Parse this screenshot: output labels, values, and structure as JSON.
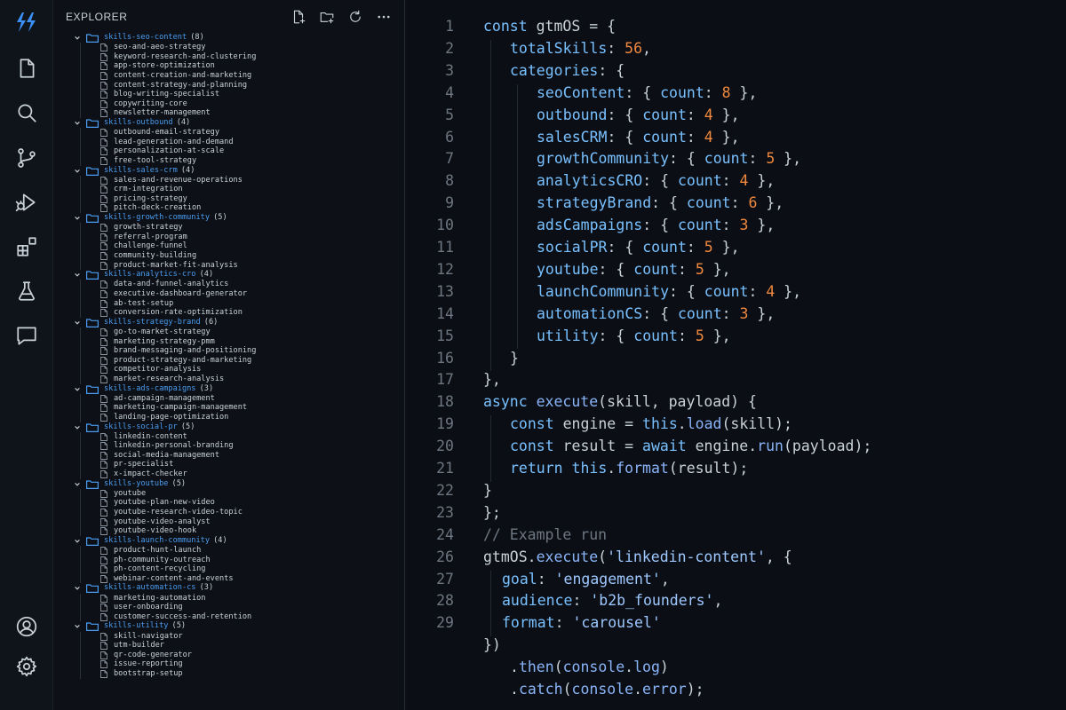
{
  "explorer": {
    "title": "EXPLORER",
    "folders": [
      {
        "name": "skills-seo-content",
        "count": "(8)",
        "files": [
          "seo-and-aeo-strategy",
          "keyword-research-and-clustering",
          "app-store-optimization",
          "content-creation-and-marketing",
          "content-strategy-and-planning",
          "blog-writing-specialist",
          "copywriting-core",
          "newsletter-management"
        ]
      },
      {
        "name": "skills-outbound",
        "count": "(4)",
        "files": [
          "outbound-email-strategy",
          "lead-generation-and-demand",
          "personalization-at-scale",
          "free-tool-strategy"
        ]
      },
      {
        "name": "skills-sales-crm",
        "count": "(4)",
        "files": [
          "sales-and-revenue-operations",
          "crm-integration",
          "pricing-strategy",
          "pitch-deck-creation"
        ]
      },
      {
        "name": "skills-growth-community",
        "count": "(5)",
        "files": [
          "growth-strategy",
          "referral-program",
          "challenge-funnel",
          "community-building",
          "product-market-fit-analysis"
        ]
      },
      {
        "name": "skills-analytics-cro",
        "count": "(4)",
        "files": [
          "data-and-funnel-analytics",
          "executive-dashboard-generator",
          "ab-test-setup",
          "conversion-rate-optimization"
        ]
      },
      {
        "name": "skills-strategy-brand",
        "count": "(6)",
        "files": [
          "go-to-market-strategy",
          "marketing-strategy-pmm",
          "brand-messaging-and-positioning",
          "product-strategy-and-marketing",
          "competitor-analysis",
          "market-research-analysis"
        ]
      },
      {
        "name": "skills-ads-campaigns",
        "count": "(3)",
        "files": [
          "ad-campaign-management",
          "marketing-campaign-management",
          "landing-page-optimization"
        ]
      },
      {
        "name": "skills-social-pr",
        "count": "(5)",
        "files": [
          "linkedin-content",
          "linkedin-personal-branding",
          "social-media-management",
          "pr-specialist",
          "x-impact-checker"
        ]
      },
      {
        "name": "skills-youtube",
        "count": "(5)",
        "files": [
          "youtube",
          "youtube-plan-new-video",
          "youtube-research-video-topic",
          "youtube-video-analyst",
          "youtube-video-hook"
        ]
      },
      {
        "name": "skills-launch-community",
        "count": "(4)",
        "files": [
          "product-hunt-launch",
          "ph-community-outreach",
          "ph-content-recycling",
          "webinar-content-and-events"
        ]
      },
      {
        "name": "skills-automation-cs",
        "count": "(3)",
        "files": [
          "marketing-automation",
          "user-onboarding",
          "customer-success-and-retention"
        ]
      },
      {
        "name": "skills-utility",
        "count": "(5)",
        "files": [
          "skill-navigator",
          "utm-builder",
          "qr-code-generator",
          "issue-reporting",
          "bootstrap-setup"
        ]
      }
    ]
  },
  "editor": {
    "lines": [
      {
        "n": "1",
        "indent": 0,
        "tokens": [
          [
            "kw",
            "const "
          ],
          [
            "pl",
            "gtmOS = {"
          ]
        ]
      },
      {
        "n": "2",
        "indent": 1,
        "tokens": [
          [
            "prop",
            "totalSkills"
          ],
          [
            "pl",
            ": "
          ],
          [
            "num",
            "56"
          ],
          [
            "pl",
            ","
          ]
        ]
      },
      {
        "n": "3",
        "indent": 1,
        "tokens": [
          [
            "prop",
            "categories"
          ],
          [
            "pl",
            ": {"
          ]
        ]
      },
      {
        "n": "4",
        "indent": 2,
        "tokens": [
          [
            "prop",
            "seoContent"
          ],
          [
            "pl",
            ": { "
          ],
          [
            "prop",
            "count"
          ],
          [
            "pl",
            ": "
          ],
          [
            "num",
            "8"
          ],
          [
            "pl",
            " },"
          ]
        ]
      },
      {
        "n": "5",
        "indent": 2,
        "tokens": [
          [
            "prop",
            "outbound"
          ],
          [
            "pl",
            ": { "
          ],
          [
            "prop",
            "count"
          ],
          [
            "pl",
            ": "
          ],
          [
            "num",
            "4"
          ],
          [
            "pl",
            " },"
          ]
        ]
      },
      {
        "n": "6",
        "indent": 2,
        "tokens": [
          [
            "prop",
            "salesCRM"
          ],
          [
            "pl",
            ": { "
          ],
          [
            "prop",
            "count"
          ],
          [
            "pl",
            ": "
          ],
          [
            "num",
            "4"
          ],
          [
            "pl",
            " },"
          ]
        ]
      },
      {
        "n": "7",
        "indent": 2,
        "tokens": [
          [
            "prop",
            "growthCommunity"
          ],
          [
            "pl",
            ": { "
          ],
          [
            "prop",
            "count"
          ],
          [
            "pl",
            ": "
          ],
          [
            "num",
            "5"
          ],
          [
            "pl",
            " },"
          ]
        ]
      },
      {
        "n": "8",
        "indent": 2,
        "tokens": [
          [
            "prop",
            "analyticsCRO"
          ],
          [
            "pl",
            ": { "
          ],
          [
            "prop",
            "count"
          ],
          [
            "pl",
            ": "
          ],
          [
            "num",
            "4"
          ],
          [
            "pl",
            " },"
          ]
        ]
      },
      {
        "n": "9",
        "indent": 2,
        "tokens": [
          [
            "prop",
            "strategyBrand"
          ],
          [
            "pl",
            ": { "
          ],
          [
            "prop",
            "count"
          ],
          [
            "pl",
            ": "
          ],
          [
            "num",
            "6"
          ],
          [
            "pl",
            " },"
          ]
        ]
      },
      {
        "n": "10",
        "indent": 2,
        "tokens": [
          [
            "prop",
            "adsCampaigns"
          ],
          [
            "pl",
            ": { "
          ],
          [
            "prop",
            "count"
          ],
          [
            "pl",
            ": "
          ],
          [
            "num",
            "3"
          ],
          [
            "pl",
            " },"
          ]
        ]
      },
      {
        "n": "11",
        "indent": 2,
        "tokens": [
          [
            "prop",
            "socialPR"
          ],
          [
            "pl",
            ": { "
          ],
          [
            "prop",
            "count"
          ],
          [
            "pl",
            ": "
          ],
          [
            "num",
            "5"
          ],
          [
            "pl",
            " },"
          ]
        ]
      },
      {
        "n": "12",
        "indent": 2,
        "tokens": [
          [
            "prop",
            "youtube"
          ],
          [
            "pl",
            ": { "
          ],
          [
            "prop",
            "count"
          ],
          [
            "pl",
            ": "
          ],
          [
            "num",
            "5"
          ],
          [
            "pl",
            " },"
          ]
        ]
      },
      {
        "n": "13",
        "indent": 2,
        "tokens": [
          [
            "prop",
            "launchCommunity"
          ],
          [
            "pl",
            ": { "
          ],
          [
            "prop",
            "count"
          ],
          [
            "pl",
            ": "
          ],
          [
            "num",
            "4"
          ],
          [
            "pl",
            " },"
          ]
        ]
      },
      {
        "n": "14",
        "indent": 2,
        "tokens": [
          [
            "prop",
            "automationCS"
          ],
          [
            "pl",
            ": { "
          ],
          [
            "prop",
            "count"
          ],
          [
            "pl",
            ": "
          ],
          [
            "num",
            "3"
          ],
          [
            "pl",
            " },"
          ]
        ]
      },
      {
        "n": "15",
        "indent": 2,
        "tokens": [
          [
            "prop",
            "utility"
          ],
          [
            "pl",
            ": { "
          ],
          [
            "prop",
            "count"
          ],
          [
            "pl",
            ": "
          ],
          [
            "num",
            "5"
          ],
          [
            "pl",
            " },"
          ]
        ]
      },
      {
        "n": "16",
        "indent": 1,
        "tokens": [
          [
            "pl",
            "}"
          ]
        ]
      },
      {
        "n": "17",
        "indent": 0,
        "tokens": [
          [
            "pl",
            "},"
          ]
        ]
      },
      {
        "n": "18",
        "indent": 0,
        "tokens": [
          [
            "kw",
            "async "
          ],
          [
            "fn",
            "execute"
          ],
          [
            "pl",
            "(skill, payload) {"
          ]
        ]
      },
      {
        "n": "19",
        "indent": 1,
        "tokens": [
          [
            "kw",
            "const "
          ],
          [
            "pl",
            "engine = "
          ],
          [
            "kw",
            "this"
          ],
          [
            "pl",
            "."
          ],
          [
            "fn",
            "load"
          ],
          [
            "pl",
            "(skill);"
          ]
        ]
      },
      {
        "n": "20",
        "indent": 1,
        "tokens": [
          [
            "kw",
            "const "
          ],
          [
            "pl",
            "result = "
          ],
          [
            "kw",
            "await "
          ],
          [
            "pl",
            "engine."
          ],
          [
            "fn",
            "run"
          ],
          [
            "pl",
            "(payload);"
          ]
        ]
      },
      {
        "n": "21",
        "indent": 1,
        "tokens": [
          [
            "kw",
            "return "
          ],
          [
            "kw",
            "this"
          ],
          [
            "pl",
            "."
          ],
          [
            "fn",
            "format"
          ],
          [
            "pl",
            "(result);"
          ]
        ]
      },
      {
        "n": "22",
        "indent": 0,
        "tokens": [
          [
            "pl",
            "}"
          ]
        ]
      },
      {
        "n": "23",
        "indent": 0,
        "tokens": [
          [
            "pl",
            "};"
          ]
        ]
      },
      {
        "n": "24",
        "indent": 0,
        "tokens": [
          [
            "cmt",
            "// Example run"
          ]
        ]
      },
      {
        "n": "26",
        "indent": 0,
        "tokens": [
          [
            "pl",
            "gtmOS."
          ],
          [
            "fn",
            "execute"
          ],
          [
            "pl",
            "("
          ],
          [
            "str",
            "'linkedin-content'"
          ],
          [
            "pl",
            ", {"
          ]
        ]
      },
      {
        "n": "27",
        "indent": 0.7,
        "tokens": [
          [
            "prop",
            "goal"
          ],
          [
            "pl",
            ": "
          ],
          [
            "str",
            "'engagement'"
          ],
          [
            "pl",
            ","
          ]
        ]
      },
      {
        "n": "28",
        "indent": 0.7,
        "tokens": [
          [
            "prop",
            "audience"
          ],
          [
            "pl",
            ": "
          ],
          [
            "str",
            "'b2b_founders'"
          ],
          [
            "pl",
            ","
          ]
        ]
      },
      {
        "n": "29",
        "indent": 0.7,
        "tokens": [
          [
            "prop",
            "format"
          ],
          [
            "pl",
            ": "
          ],
          [
            "str",
            "'carousel'"
          ]
        ]
      },
      {
        "n": "",
        "indent": 0,
        "tokens": [
          [
            "pl",
            "})"
          ]
        ]
      },
      {
        "n": "",
        "indent": 1,
        "tokens": [
          [
            "pl",
            "."
          ],
          [
            "fn",
            "then"
          ],
          [
            "pl",
            "("
          ],
          [
            "fn",
            "console"
          ],
          [
            "pl",
            "."
          ],
          [
            "fn",
            "log"
          ],
          [
            "pl",
            ")"
          ]
        ]
      },
      {
        "n": "",
        "indent": 1,
        "tokens": [
          [
            "pl",
            "."
          ],
          [
            "fn",
            "catch"
          ],
          [
            "pl",
            "("
          ],
          [
            "fn",
            "console"
          ],
          [
            "pl",
            "."
          ],
          [
            "fn",
            "error"
          ],
          [
            "pl",
            ");"
          ]
        ]
      }
    ]
  },
  "colors": {
    "accent": "#4a9cf0",
    "number": "#f0883e",
    "background": "#0b0f15"
  }
}
